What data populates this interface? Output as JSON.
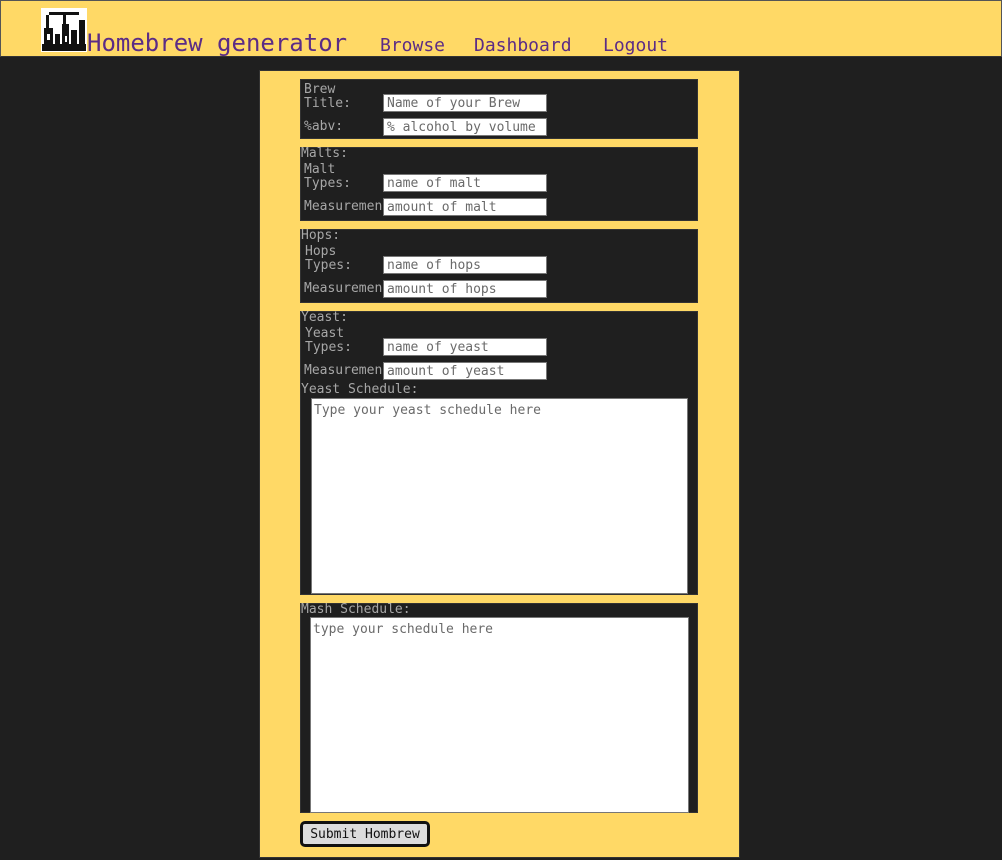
{
  "header": {
    "brand": "Homebrew generator",
    "nav": {
      "browse": "Browse",
      "dashboard": "Dashboard",
      "logout": "Logout"
    }
  },
  "form": {
    "brew": {
      "title_label": "Brew\nTitle:",
      "title_placeholder": "Name of your Brew",
      "abv_label": "%abv:",
      "abv_placeholder": "% alcohol by volume"
    },
    "malts": {
      "legend": "Malts:",
      "types_label": "Malt\nTypes:",
      "types_placeholder": "name of malt",
      "measure_label": "Measurement",
      "measure_placeholder": "amount of malt"
    },
    "hops": {
      "legend": "Hops:",
      "types_label": "Hops\nTypes:",
      "types_placeholder": "name of hops",
      "measure_label": "Measurement",
      "measure_placeholder": "amount of hops"
    },
    "yeast": {
      "legend": "Yeast:",
      "types_label": "Yeast\nTypes:",
      "types_placeholder": "name of yeast",
      "measure_label": "Measurement",
      "measure_placeholder": "amount of yeast",
      "schedule_label": "Yeast Schedule:",
      "schedule_placeholder": "Type your yeast schedule here"
    },
    "mash": {
      "legend": "Mash Schedule:",
      "schedule_placeholder": "type your schedule here"
    },
    "submit_label": "Submit Hombrew"
  }
}
